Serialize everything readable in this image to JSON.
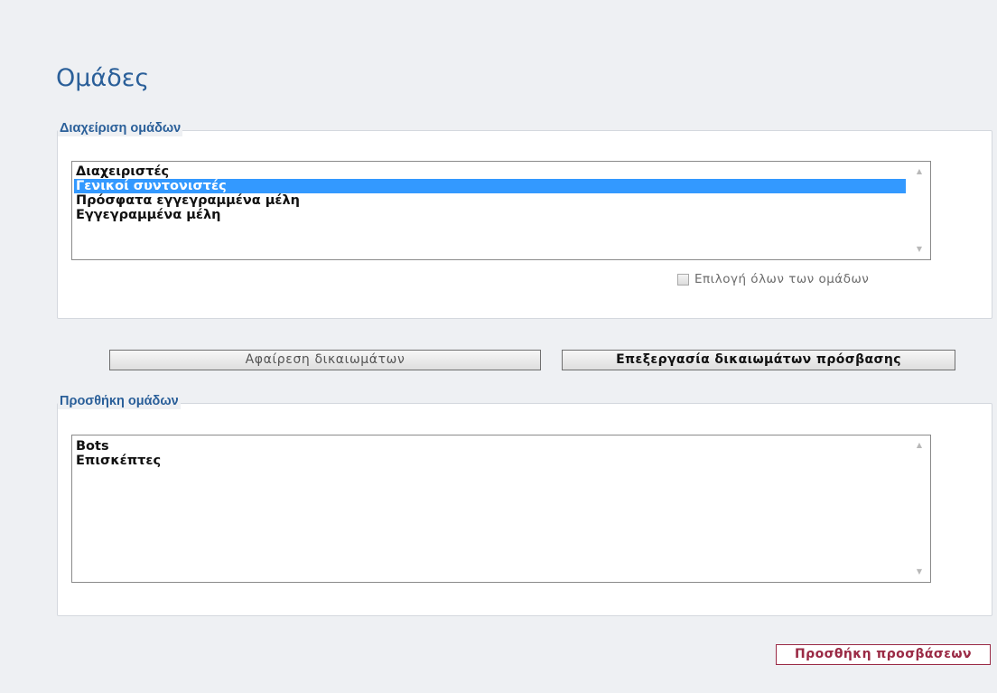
{
  "page": {
    "title": "Ομάδες"
  },
  "manage_groups": {
    "legend": "Διαχείριση ομάδων",
    "items": [
      {
        "label": "Διαχειριστές",
        "selected": false
      },
      {
        "label": "Γενικοί συντονιστές",
        "selected": true
      },
      {
        "label": "Πρόσφατα εγγεγραμμένα μέλη",
        "selected": false
      },
      {
        "label": "Εγγεγραμμένα μέλη",
        "selected": false
      }
    ],
    "select_all_label": "Επιλογή όλων των ομάδων",
    "select_all_checked": false
  },
  "actions": {
    "remove_label": "Αφαίρεση δικαιωμάτων",
    "edit_label": "Επεξεργασία δικαιωμάτων πρόσβασης"
  },
  "add_groups": {
    "legend": "Προσθήκη ομάδων",
    "items": [
      {
        "label": "Bots",
        "selected": false
      },
      {
        "label": "Επισκέπτες",
        "selected": false
      }
    ]
  },
  "footer": {
    "add_permissions_label": "Προσθήκη προσβάσεων"
  },
  "icons": {
    "scroll_up": "scroll-up-arrow-icon",
    "scroll_down": "scroll-down-arrow-icon"
  },
  "colors": {
    "title": "#2a5f99",
    "selection": "#3399ff",
    "add_button": "#9a2a45"
  }
}
